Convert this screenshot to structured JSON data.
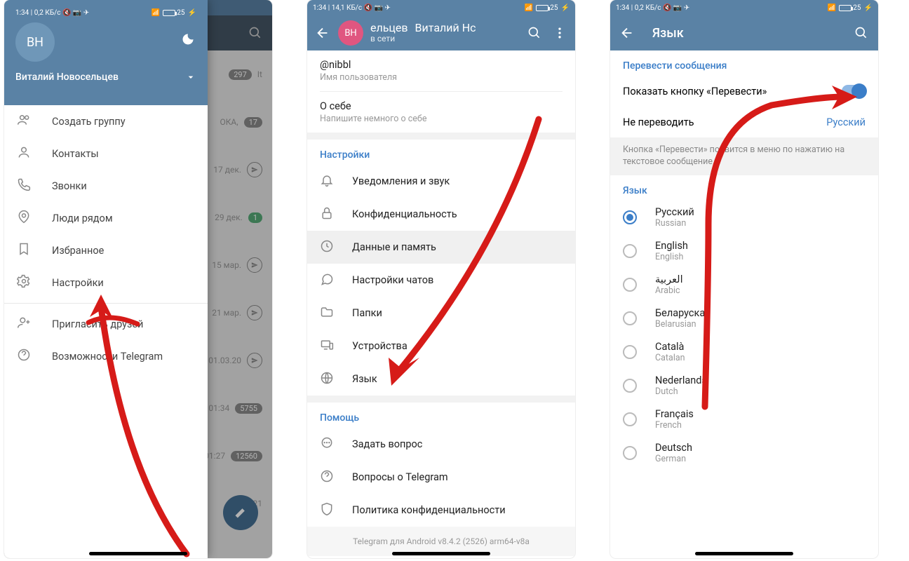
{
  "status": {
    "time": "1:34",
    "net1": "0,2 КБ/с",
    "net2": "14,1 КБ/с",
    "batt": "25"
  },
  "p1": {
    "initials": "ВН",
    "name": "Виталий Новосельцев",
    "drawer": [
      {
        "icon": "group",
        "label": "Создать группу"
      },
      {
        "icon": "person",
        "label": "Контакты"
      },
      {
        "icon": "phone",
        "label": "Звонки"
      },
      {
        "icon": "near",
        "label": "Люди рядом"
      },
      {
        "icon": "bookmark",
        "label": "Избранное"
      },
      {
        "icon": "settings",
        "label": "Настройки"
      },
      {
        "icon": "invite",
        "label": "Пригласить друзей"
      },
      {
        "icon": "help",
        "label": "Возможности Telegram"
      }
    ],
    "bg": [
      {
        "t": "",
        "b": "297",
        "extra": "It"
      },
      {
        "t": "ОКА,",
        "b": "17"
      },
      {
        "t": "17 дек.",
        "c": "1"
      },
      {
        "t": "29 дек.",
        "b2": "1"
      },
      {
        "t": "15 мар.",
        "c": "1"
      },
      {
        "t": "21 мар.",
        "c": "1"
      },
      {
        "t": "✓ 01.03.20",
        "c": "1"
      },
      {
        "t": "✓ 01:34",
        "b": "5755"
      },
      {
        "t": "01:27",
        "b": "12560"
      },
      {
        "t": "01:21"
      }
    ]
  },
  "p2": {
    "initials": "ВН",
    "nameline": "Виталий Нс",
    "nameline2": "ельцев",
    "status": "в сети",
    "top": [
      {
        "l": "@nibbl",
        "s": "Имя пользователя"
      },
      {
        "l": "О себе",
        "s": "Напишите немного о себе"
      }
    ],
    "sect": "Настройки",
    "rows": [
      {
        "icon": "bell",
        "l": "Уведомления и звук"
      },
      {
        "icon": "lock",
        "l": "Конфиденциальность"
      },
      {
        "icon": "clock",
        "l": "Данные и память",
        "active": true
      },
      {
        "icon": "chat",
        "l": "Настройки чатов"
      },
      {
        "icon": "folder",
        "l": "Папки"
      },
      {
        "icon": "devices",
        "l": "Устройства"
      },
      {
        "icon": "globe",
        "l": "Язык"
      }
    ],
    "help": "Помощь",
    "helprows": [
      {
        "icon": "msg",
        "l": "Задать вопрос"
      },
      {
        "icon": "q",
        "l": "Вопросы о Telegram"
      },
      {
        "icon": "shield",
        "l": "Политика конфиденциальности"
      }
    ],
    "footer": "Telegram для Android v8.4.2 (2526) arm64-v8a"
  },
  "p3": {
    "title": "Язык",
    "sect1": "Перевести сообщения",
    "i1": "Показать кнопку «Перевести»",
    "i2": "Не переводить",
    "i2v": "Русский",
    "hint": "Кнопка «Перевести» появится в меню по нажатию на текстовое сообщение.",
    "sect2": "Язык",
    "langs": [
      {
        "n": "Русский",
        "s": "Russian",
        "on": true
      },
      {
        "n": "English",
        "s": "English"
      },
      {
        "n": "العربية",
        "s": "Arabic"
      },
      {
        "n": "Беларуская",
        "s": "Belarusian"
      },
      {
        "n": "Català",
        "s": "Catalan"
      },
      {
        "n": "Nederlands",
        "s": "Dutch"
      },
      {
        "n": "Français",
        "s": "French"
      },
      {
        "n": "Deutsch",
        "s": "German"
      }
    ]
  }
}
